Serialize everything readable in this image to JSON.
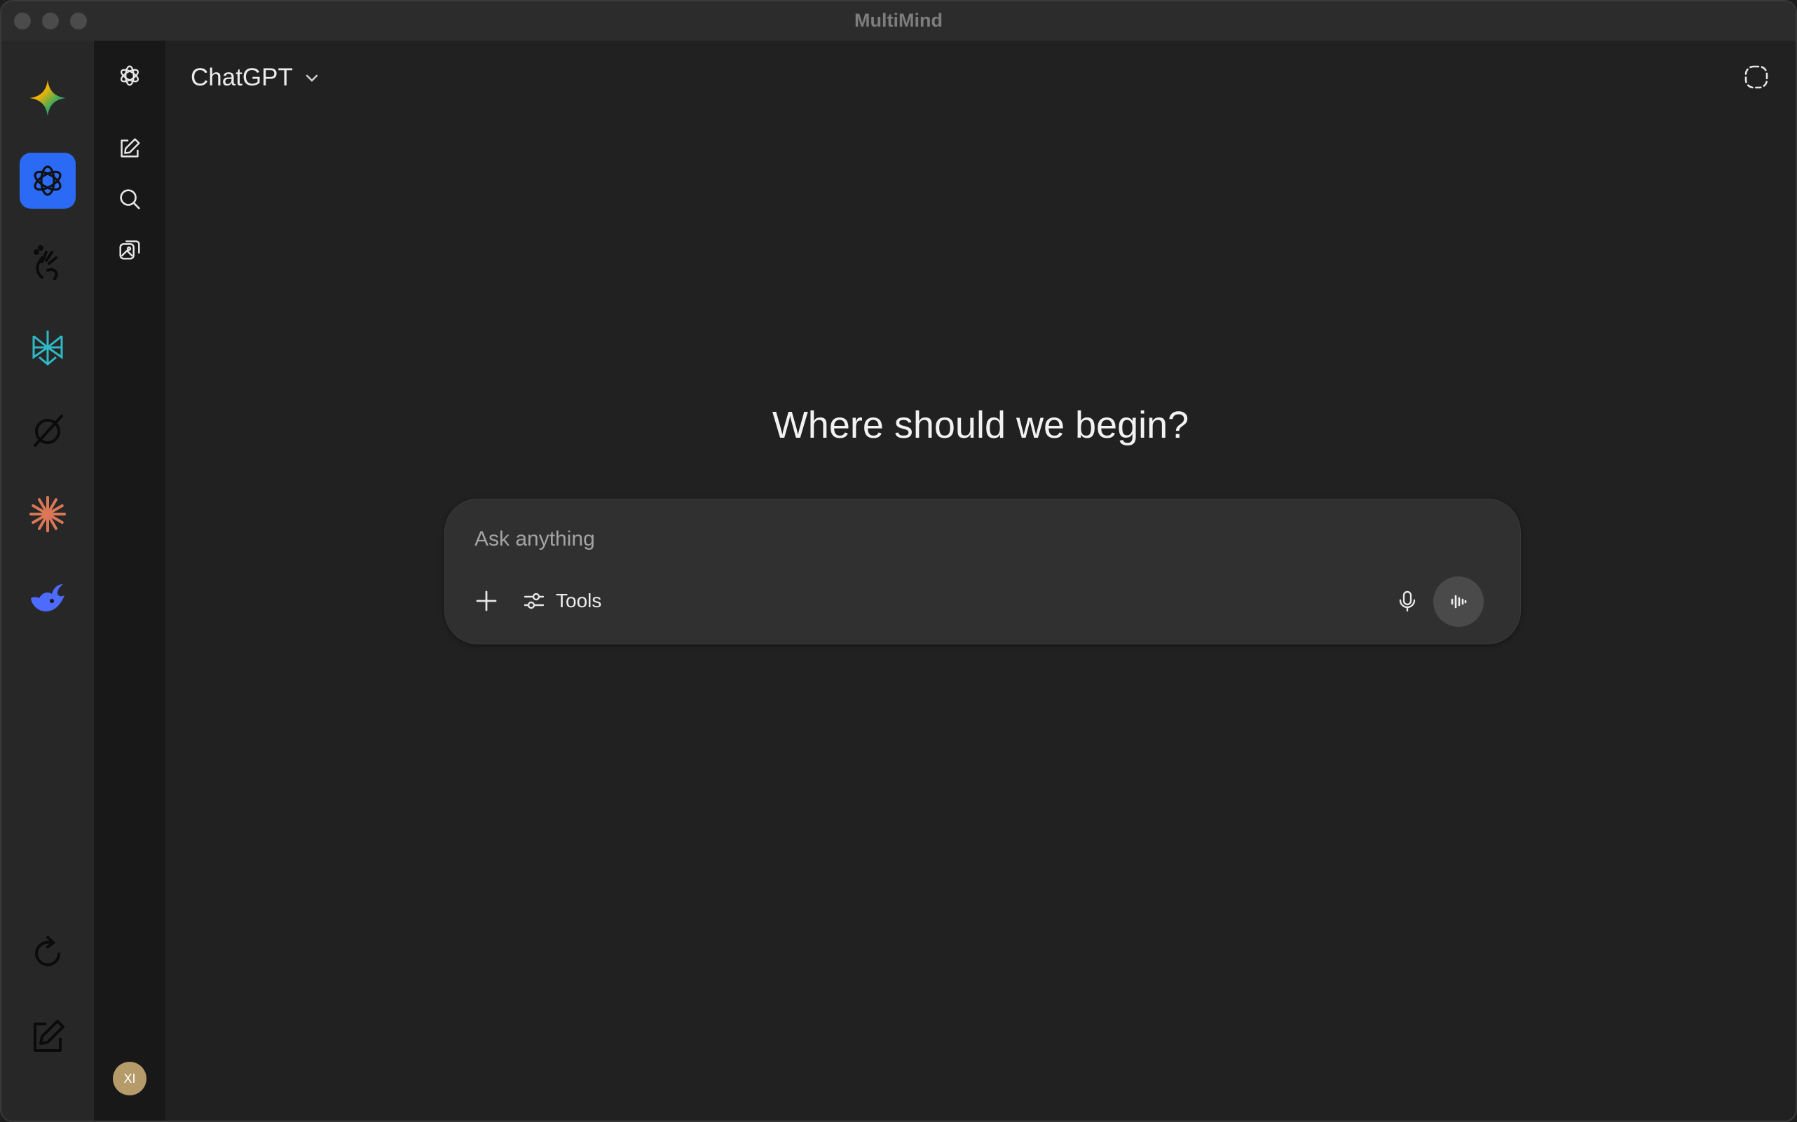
{
  "window": {
    "title": "MultiMind"
  },
  "rail": {
    "items": [
      {
        "name": "gemini",
        "icon": "gemini-sparkle-icon"
      },
      {
        "name": "chatgpt",
        "icon": "openai-icon",
        "active": true
      },
      {
        "name": "grok-hand",
        "icon": "hand-icon"
      },
      {
        "name": "perplexity",
        "icon": "perplexity-icon"
      },
      {
        "name": "grok",
        "icon": "grok-icon"
      },
      {
        "name": "claude",
        "icon": "claude-starburst-icon"
      },
      {
        "name": "deepseek",
        "icon": "deepseek-whale-icon"
      }
    ],
    "bottom": [
      {
        "name": "reload",
        "icon": "reload-icon"
      },
      {
        "name": "edit",
        "icon": "edit-icon"
      }
    ]
  },
  "sidebar": {
    "user_initials": "XI"
  },
  "main": {
    "model_name": "ChatGPT",
    "headline": "Where should we begin?",
    "composer": {
      "placeholder": "Ask anything",
      "tools_label": "Tools"
    }
  },
  "colors": {
    "accent": "#2a6af5",
    "background": "#212121",
    "composer": "#303030"
  }
}
